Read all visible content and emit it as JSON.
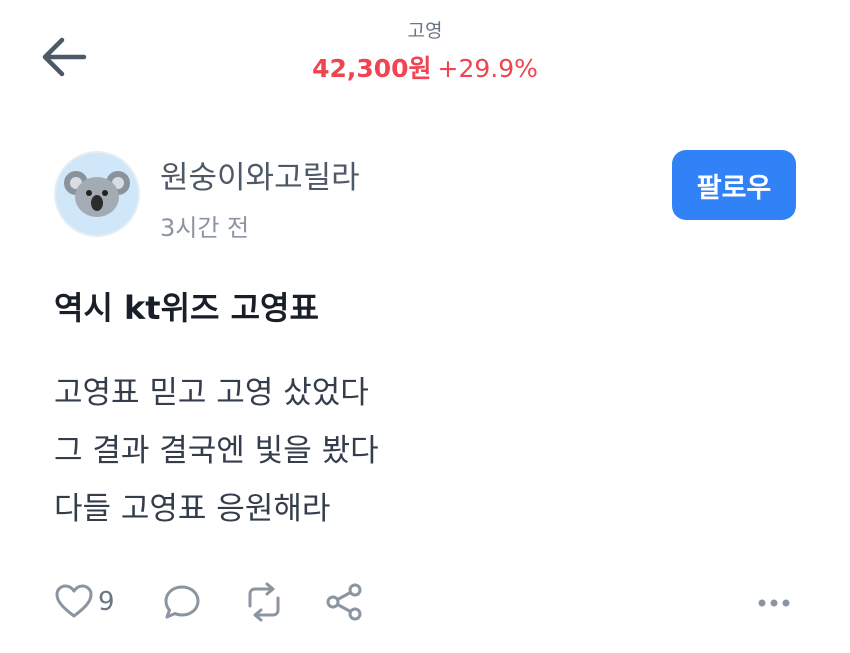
{
  "header": {
    "back_icon": "arrow-left-icon",
    "stock_name": "고영",
    "price": "42,300원",
    "change": "+29.9%",
    "price_color": "#f04452"
  },
  "post": {
    "author": "원숭이와고릴라",
    "time": "3시간 전",
    "avatar_icon": "koala-icon",
    "follow_label": "팔로우",
    "follow_color": "#3182f6",
    "title": "역시 kt위즈 고영표",
    "body_lines": [
      "고영표 믿고 고영 샀었다",
      "그 결과 결국엔 빛을 봤다",
      "다들 고영표 응원해라"
    ]
  },
  "actions": {
    "like_icon": "heart-icon",
    "like_count": "9",
    "comment_icon": "comment-icon",
    "repost_icon": "repost-icon",
    "share_icon": "share-icon",
    "more_icon": "more-icon"
  }
}
